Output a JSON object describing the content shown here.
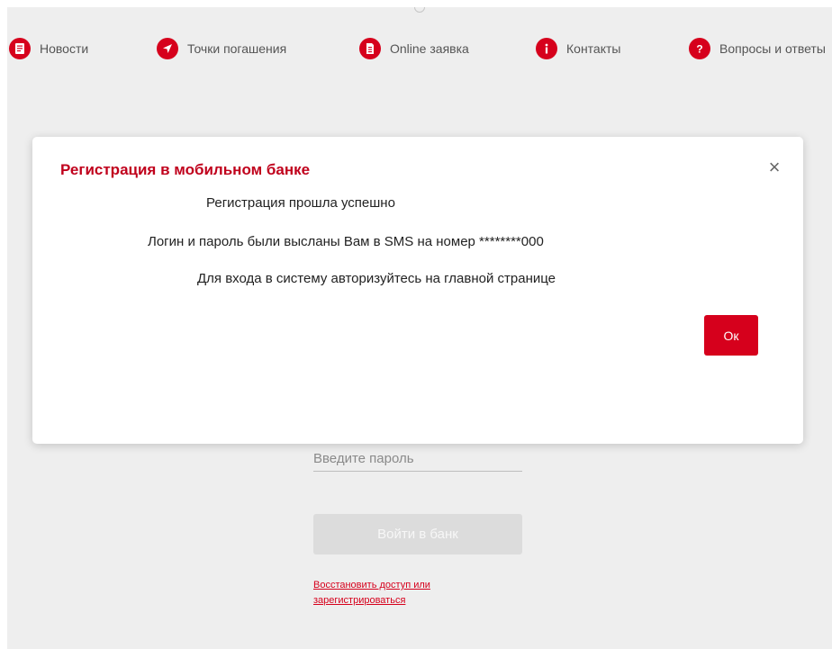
{
  "nav": {
    "items": [
      {
        "label": "Новости",
        "icon": "news-icon"
      },
      {
        "label": "Точки погашения",
        "icon": "location-arrow-icon"
      },
      {
        "label": "Online заявка",
        "icon": "document-icon"
      },
      {
        "label": "Контакты",
        "icon": "info-icon"
      },
      {
        "label": "Вопросы и ответы",
        "icon": "question-icon"
      }
    ],
    "accent_color": "#d6001c"
  },
  "login": {
    "password_placeholder": "Введите пароль",
    "submit_label": "Войти в банк",
    "restore_link": "Восстановить доступ или зарегистрироваться"
  },
  "modal": {
    "title": "Регистрация в мобильном банке",
    "close_symbol": "×",
    "messages": [
      "Регистрация прошла успешно",
      "Логин и пароль были высланы Вам в SMS на номер ********000",
      "Для входа в систему авторизуйтесь на главной странице"
    ],
    "ok_label": "Ок"
  }
}
